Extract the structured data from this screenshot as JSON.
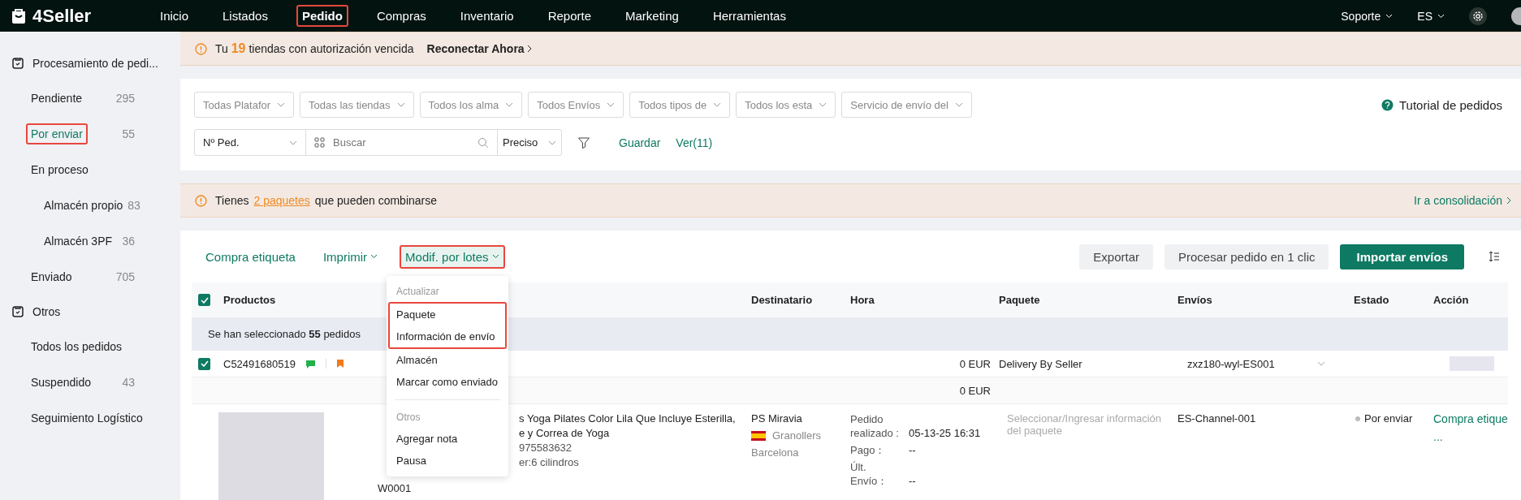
{
  "nav": {
    "logo": "4Seller",
    "items": [
      {
        "label": "Inicio",
        "selected": false,
        "highlighted": false
      },
      {
        "label": "Listados",
        "selected": false,
        "highlighted": false
      },
      {
        "label": "Pedido",
        "selected": true,
        "highlighted": true
      },
      {
        "label": "Compras",
        "selected": false,
        "highlighted": false
      },
      {
        "label": "Inventario",
        "selected": false,
        "highlighted": false
      },
      {
        "label": "Reporte",
        "selected": false,
        "highlighted": false
      },
      {
        "label": "Marketing",
        "selected": false,
        "highlighted": false
      },
      {
        "label": "Herramientas",
        "selected": false,
        "highlighted": false
      }
    ],
    "right": [
      "Soporte",
      "ES"
    ]
  },
  "sidebar": {
    "groups": [
      {
        "title": "Procesamiento de pedi...",
        "items": [
          {
            "label": "Pendiente",
            "count": "295",
            "selected": false,
            "highlighted": false
          },
          {
            "label": "Por enviar",
            "count": "55",
            "selected": true,
            "highlighted": true
          },
          {
            "label": "En proceso",
            "selected": false,
            "highlighted": false,
            "children": [
              {
                "label": "Almacén propio",
                "count": "83",
                "selected": false,
                "highlighted": false
              },
              {
                "label": "Almacén 3PF",
                "count": "36",
                "selected": false,
                "highlighted": false
              }
            ]
          },
          {
            "label": "Enviado",
            "count": "705",
            "selected": false,
            "highlighted": false
          }
        ]
      },
      {
        "title": "Otros",
        "items": [
          {
            "label": "Todos los pedidos",
            "selected": false,
            "highlighted": false
          },
          {
            "label": "Suspendido",
            "count": "43",
            "selected": false,
            "highlighted": false
          },
          {
            "label": "Seguimiento Logístico",
            "selected": false,
            "highlighted": false
          }
        ]
      }
    ]
  },
  "banner_top": {
    "prefix": "Tu",
    "count": "19",
    "text": "tiendas con autorización vencida",
    "link": "Reconectar Ahora"
  },
  "filters": {
    "dropdowns": [
      "Todas Platafor",
      "Todas las tiendas",
      "Todos los alma",
      "Todos Envíos",
      "Todos tipos de",
      "Todos los esta",
      "Servicio de envío del"
    ],
    "tutorial": "Tutorial de pedidos",
    "search_type": "Nº Ped.",
    "search": {
      "placeholder": "Buscar"
    },
    "match": "Preciso",
    "save": "Guardar",
    "views": "Ver(11)"
  },
  "banner_combine": {
    "prefix": "Tienes",
    "link": "2 paquetes",
    "text": "que pueden combinarse",
    "action": "Ir a consolidación"
  },
  "toolbar": {
    "left": [
      {
        "label": "Compra etiqueta",
        "kind": "link",
        "highlighted": false,
        "expanded": false
      },
      {
        "label": "Imprimir",
        "kind": "menu",
        "highlighted": false,
        "expanded": false
      },
      {
        "label": "Modif. por lotes",
        "kind": "menu",
        "highlighted": true,
        "expanded": true
      }
    ],
    "buttons": [
      {
        "label": "Exportar",
        "primary": false
      },
      {
        "label": "Procesar pedido en 1 clic",
        "primary": false
      },
      {
        "label": "Importar envíos",
        "primary": true
      }
    ]
  },
  "menu": {
    "sections": [
      {
        "title": "Actualizar",
        "items": [
          {
            "label": "Paquete",
            "highlighted": true
          },
          {
            "label": "Información de envío",
            "highlighted": true
          },
          {
            "label": "Almacén",
            "highlighted": false
          },
          {
            "label": "Marcar como enviado",
            "highlighted": false
          }
        ]
      },
      {
        "title": "Otros",
        "items": [
          {
            "label": "Agregar nota",
            "highlighted": false
          },
          {
            "label": "Pausa",
            "highlighted": false
          }
        ]
      }
    ]
  },
  "table": {
    "all_checked": true,
    "columns": [
      "Productos",
      "Destinatario",
      "Hora",
      "Paquete",
      "Envíos",
      "Estado",
      "Acción"
    ],
    "selection_note": "Se han seleccionado **55** pedidos",
    "order": {
      "checked": true,
      "id": "C52491680519",
      "amount": "0 EUR",
      "package_type": "Delivery By Seller",
      "shipping_account": "zxz180-wyl-ES001",
      "subtotal": "0 EUR",
      "product": {
        "title_lines": [
          "s Yoga Pilates Color Lila Que Incluye Esterilla,",
          "e y Correa de Yoga"
        ],
        "sku": "975583632",
        "variant": "er:6 cilindros",
        "warehouse": "W0001"
      },
      "recipient": {
        "name": "PS Miravia",
        "city": "Granollers",
        "region": "Barcelona"
      },
      "times": [
        {
          "label": "Pedido realizado :",
          "value": "05-13-25 16:31"
        },
        {
          "label": "Pago：",
          "value": "--"
        },
        {
          "label": "Últ. Envío：",
          "value": "--"
        }
      ],
      "package": {
        "placeholder": "Seleccionar/Ingresar información del paquete"
      },
      "channel": "ES-Channel-001",
      "status": "Por enviar",
      "action": "Compra etique",
      "more": "..."
    }
  }
}
